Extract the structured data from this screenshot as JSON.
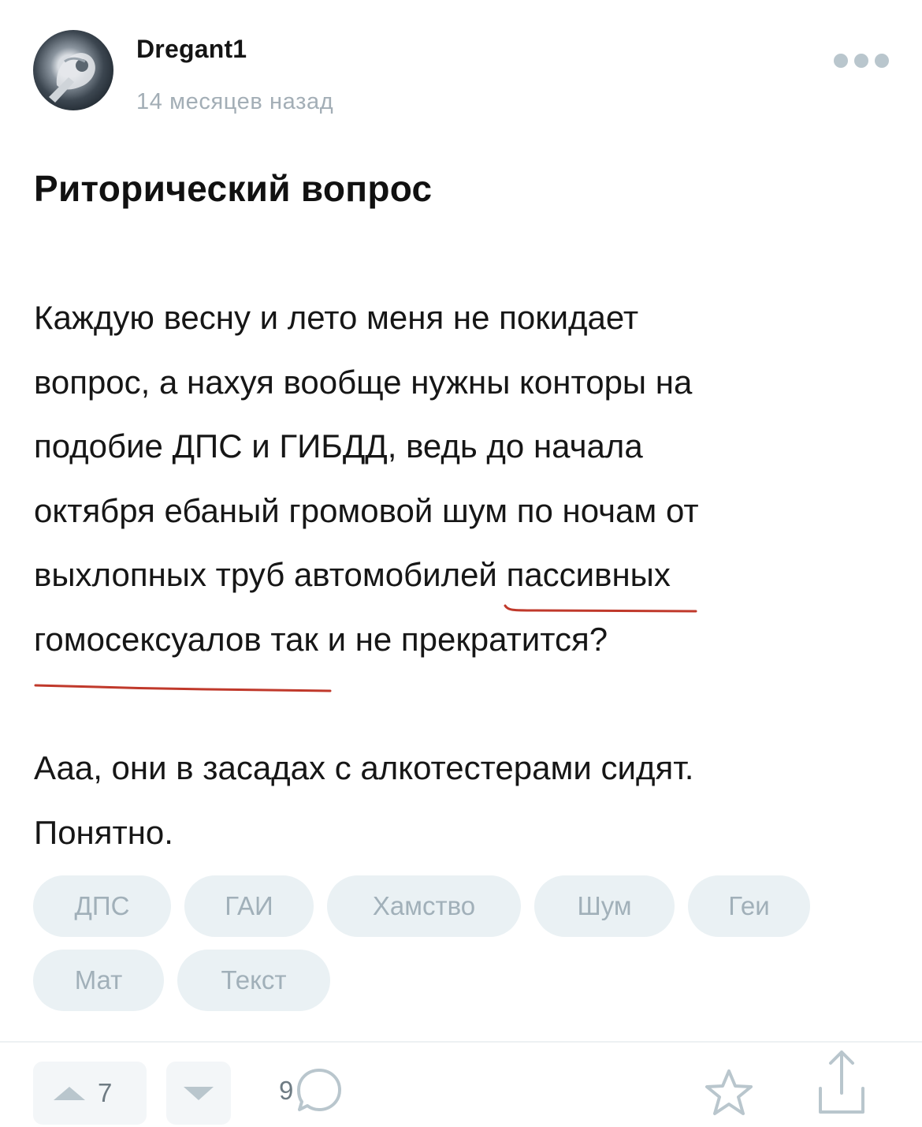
{
  "post": {
    "author": "Dregant1",
    "time": "14 месяцев назад",
    "title": "Риторический вопрос",
    "body_lines_p1": [
      "Каждую весну и лето меня не покидает",
      "вопрос, а нахуя вообще нужны конторы на",
      "подобие ДПС и ГИБДД, ведь до начала",
      "октября ебаный громовой шум по ночам от"
    ],
    "line5_prefix": "выхлопных труб автомобилей ",
    "line5_underlined": "пассивных",
    "line6_underlined": "гомосексуалов",
    "line6_suffix": " так и не прекратится?",
    "body_lines_p2": [
      "Ааа, они в засадах с алкотестерами сидят.",
      "Понятно."
    ],
    "underline_color": "#c0392b"
  },
  "tags": [
    "ДПС",
    "ГАИ",
    "Хамство",
    "Шум",
    "Геи",
    "Мат",
    "Текст"
  ],
  "actions": {
    "upvotes": "7",
    "comments": "9",
    "icon_color": "#b9c6cd"
  }
}
